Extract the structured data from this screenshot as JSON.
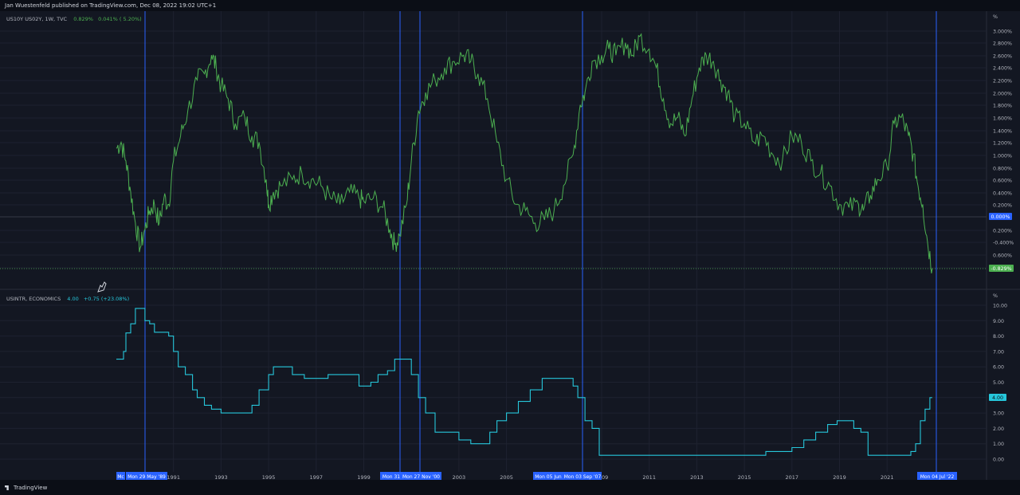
{
  "header": {
    "publisher_line": "Jan Wuestenfeld published on TradingView.com, Dec 08, 2022 19:02 UTC+1"
  },
  "footer": {
    "logo_text": "TradingView"
  },
  "colors": {
    "spread_line": "#4caf50",
    "rate_line": "#26c6da",
    "accent_blue": "#2962ff",
    "background": "#131722",
    "grid": "#1e2230"
  },
  "legends": {
    "top": {
      "symbol": "US10Y US02Y, 1W, TVC",
      "value": "0.829%",
      "change": "0.041% ( 5.20%)"
    },
    "bottom": {
      "symbol": "USINTR, ECONOMICS",
      "value": "4.00",
      "change": "+0.75 (+23.08%)"
    }
  },
  "axis_units": {
    "top": "%",
    "bottom": "%"
  },
  "price_badges": {
    "zero": "0.000%",
    "last": "-0.829%",
    "rate_last": "4.00"
  },
  "time_badges": [
    "Mc",
    "Mon 29 May '89",
    "Mon 31",
    "Mon 27 Nov '00",
    "Mon 05 Jun",
    "Mon 03 Sep '07",
    "Mon 04 Jul '22"
  ],
  "chart_data": [
    {
      "type": "line",
      "title": "US10Y US02Y, 1W, TVC",
      "x_tick_labels": [
        "1991",
        "1993",
        "1995",
        "1997",
        "1999",
        "2003",
        "2005",
        "2009",
        "2011",
        "2013",
        "2015",
        "2017",
        "2019",
        "2021"
      ],
      "y_tick_labels": [
        "3.000%",
        "2.800%",
        "2.600%",
        "2.400%",
        "2.200%",
        "2.000%",
        "1.800%",
        "1.600%",
        "1.400%",
        "1.200%",
        "1.000%",
        "0.800%",
        "0.600%",
        "0.400%",
        "0.200%",
        "0.200%",
        "-0.400%",
        "0.600%",
        "1.000%"
      ],
      "y_unit": "%",
      "ylim": [
        -1.0,
        3.2
      ],
      "x": [
        1988.6,
        1988.8,
        1989.0,
        1989.2,
        1989.4,
        1989.6,
        1989.8,
        1990.0,
        1990.2,
        1990.4,
        1990.6,
        1990.8,
        1991.0,
        1991.3,
        1991.6,
        1992.0,
        1992.3,
        1992.6,
        1992.8,
        1993.0,
        1993.3,
        1993.6,
        1994.0,
        1994.3,
        1994.6,
        1994.9,
        1995.0,
        1995.2,
        1995.5,
        1996.0,
        1996.4,
        1996.8,
        1997.2,
        1997.6,
        1998.0,
        1998.4,
        1998.8,
        1999.0,
        1999.4,
        1999.8,
        2000.1,
        2000.3,
        2000.5,
        2000.8,
        2001.0,
        2001.3,
        2001.6,
        2002.0,
        2002.4,
        2002.8,
        2003.2,
        2003.5,
        2003.8,
        2004.2,
        2004.6,
        2005.0,
        2005.4,
        2005.8,
        2006.2,
        2006.6,
        2007.0,
        2007.4,
        2007.8,
        2008.1,
        2008.3,
        2008.6,
        2009.0,
        2009.3,
        2009.6,
        2010.0,
        2010.3,
        2010.6,
        2011.0,
        2011.3,
        2011.6,
        2011.9,
        2012.2,
        2012.5,
        2012.8,
        2013.1,
        2013.4,
        2013.7,
        2014.0,
        2014.3,
        2014.6,
        2015.0,
        2015.4,
        2015.8,
        2016.2,
        2016.6,
        2017.0,
        2017.4,
        2017.8,
        2018.2,
        2018.6,
        2019.0,
        2019.4,
        2019.8,
        2020.0,
        2020.3,
        2020.6,
        2021.0,
        2021.3,
        2021.6,
        2021.9,
        2022.1,
        2022.3,
        2022.5,
        2022.7,
        2022.9
      ],
      "y": [
        1.1,
        1.2,
        0.9,
        0.4,
        -0.1,
        -0.5,
        -0.2,
        0.1,
        0.2,
        -0.1,
        0.3,
        0.2,
        0.9,
        1.3,
        1.7,
        2.2,
        2.3,
        2.6,
        2.4,
        2.1,
        1.9,
        1.5,
        1.6,
        1.3,
        1.2,
        0.6,
        0.2,
        0.4,
        0.5,
        0.6,
        0.7,
        0.6,
        0.5,
        0.3,
        0.2,
        0.4,
        0.3,
        0.25,
        0.3,
        0.15,
        -0.2,
        -0.45,
        -0.3,
        0.2,
        0.9,
        1.7,
        2.0,
        2.2,
        2.4,
        2.5,
        2.6,
        2.5,
        2.3,
        1.9,
        1.2,
        0.6,
        0.2,
        0.1,
        -0.1,
        -0.05,
        0.1,
        0.5,
        1.0,
        1.8,
        2.0,
        2.5,
        2.6,
        2.7,
        2.6,
        2.8,
        2.6,
        2.9,
        2.7,
        2.4,
        1.9,
        1.5,
        1.6,
        1.3,
        1.9,
        2.4,
        2.6,
        2.5,
        2.2,
        2.0,
        1.6,
        1.5,
        1.2,
        1.3,
        1.0,
        0.9,
        1.3,
        1.2,
        0.9,
        0.7,
        0.5,
        0.2,
        0.15,
        0.2,
        0.1,
        0.35,
        0.6,
        0.8,
        1.5,
        1.6,
        1.3,
        1.0,
        0.5,
        0.2,
        -0.4,
        -0.83
      ]
    },
    {
      "type": "line",
      "title": "USINTR, ECONOMICS",
      "x_tick_labels": [
        "1991",
        "1993",
        "1995",
        "1997",
        "1999",
        "2003",
        "2005",
        "2009",
        "2011",
        "2013",
        "2015",
        "2017",
        "2019",
        "2021"
      ],
      "y_tick_labels": [
        "10.00",
        "9.00",
        "8.00",
        "7.00",
        "6.00",
        "5.00",
        "4.00",
        "3.00",
        "2.00",
        "1.00",
        "0.00"
      ],
      "ylim": [
        -0.5,
        10.5
      ],
      "x": [
        1988.6,
        1988.9,
        1989.0,
        1989.2,
        1989.4,
        1989.6,
        1989.8,
        1990.0,
        1990.2,
        1990.5,
        1990.8,
        1991.0,
        1991.2,
        1991.5,
        1991.8,
        1992.0,
        1992.3,
        1992.6,
        1993.0,
        1993.5,
        1994.0,
        1994.3,
        1994.6,
        1995.0,
        1995.2,
        1995.5,
        1996.0,
        1996.5,
        1997.0,
        1997.5,
        1998.0,
        1998.5,
        1998.8,
        1999.0,
        1999.3,
        1999.6,
        2000.0,
        2000.3,
        2000.5,
        2000.9,
        2001.0,
        2001.3,
        2001.6,
        2002.0,
        2002.5,
        2003.0,
        2003.5,
        2004.0,
        2004.3,
        2004.6,
        2005.0,
        2005.5,
        2006.0,
        2006.5,
        2007.0,
        2007.5,
        2007.8,
        2008.0,
        2008.3,
        2008.6,
        2008.9,
        2009.5,
        2010.0,
        2011.0,
        2012.0,
        2013.0,
        2014.0,
        2015.0,
        2015.9,
        2016.5,
        2017.0,
        2017.5,
        2018.0,
        2018.5,
        2018.9,
        2019.3,
        2019.6,
        2019.9,
        2020.2,
        2020.5,
        2021.0,
        2021.5,
        2022.0,
        2022.2,
        2022.4,
        2022.6,
        2022.8,
        2022.9
      ],
      "y": [
        6.5,
        7.0,
        8.2,
        8.8,
        9.8,
        9.8,
        9.0,
        8.8,
        8.25,
        8.25,
        8.0,
        7.0,
        6.0,
        5.5,
        4.5,
        4.0,
        3.5,
        3.25,
        3.0,
        3.0,
        3.0,
        3.5,
        4.5,
        5.5,
        6.0,
        6.0,
        5.5,
        5.25,
        5.25,
        5.5,
        5.5,
        5.5,
        4.75,
        4.75,
        5.0,
        5.5,
        5.75,
        6.5,
        6.5,
        6.5,
        5.5,
        4.0,
        3.0,
        1.75,
        1.75,
        1.25,
        1.0,
        1.0,
        1.75,
        2.5,
        3.0,
        3.75,
        4.5,
        5.25,
        5.25,
        5.25,
        4.75,
        4.0,
        2.5,
        2.0,
        0.25,
        0.25,
        0.25,
        0.25,
        0.25,
        0.25,
        0.25,
        0.25,
        0.5,
        0.5,
        0.75,
        1.25,
        1.75,
        2.25,
        2.5,
        2.5,
        2.0,
        1.75,
        0.25,
        0.25,
        0.25,
        0.25,
        0.5,
        1.0,
        2.5,
        3.25,
        4.0,
        4.0
      ]
    }
  ]
}
